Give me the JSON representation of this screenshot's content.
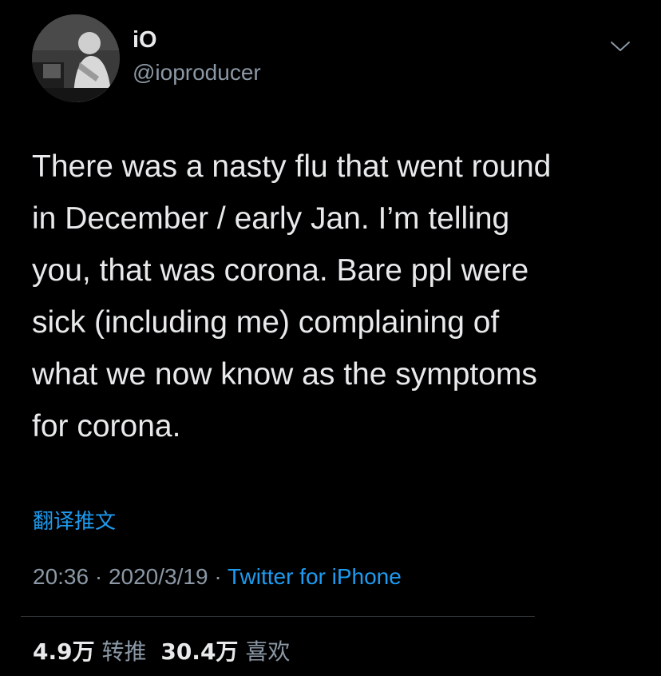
{
  "author": {
    "name": "iO",
    "handle": "@ioproducer",
    "avatar_icon": "profile-photo-icon"
  },
  "menu": {
    "icon": "chevron-down-icon"
  },
  "tweet": {
    "text": "There was a nasty flu that went round\nin December / early Jan. I’m telling\nyou, that was corona. Bare ppl were\nsick (including me) complaining of\nwhat we now know as the symptoms\nfor corona.",
    "translate_label": "翻译推文"
  },
  "meta": {
    "time": "20:36",
    "separator": " · ",
    "date": "2020/3/19",
    "source": "Twitter for iPhone"
  },
  "stats": {
    "retweets_count": "4.9万",
    "retweets_label": "转推",
    "likes_count": "30.4万",
    "likes_label": "喜欢"
  },
  "colors": {
    "background": "#000000",
    "text": "#e7e9ea",
    "secondary": "#8b98a5",
    "link": "#1d9bf0",
    "divider": "#2f3336"
  }
}
